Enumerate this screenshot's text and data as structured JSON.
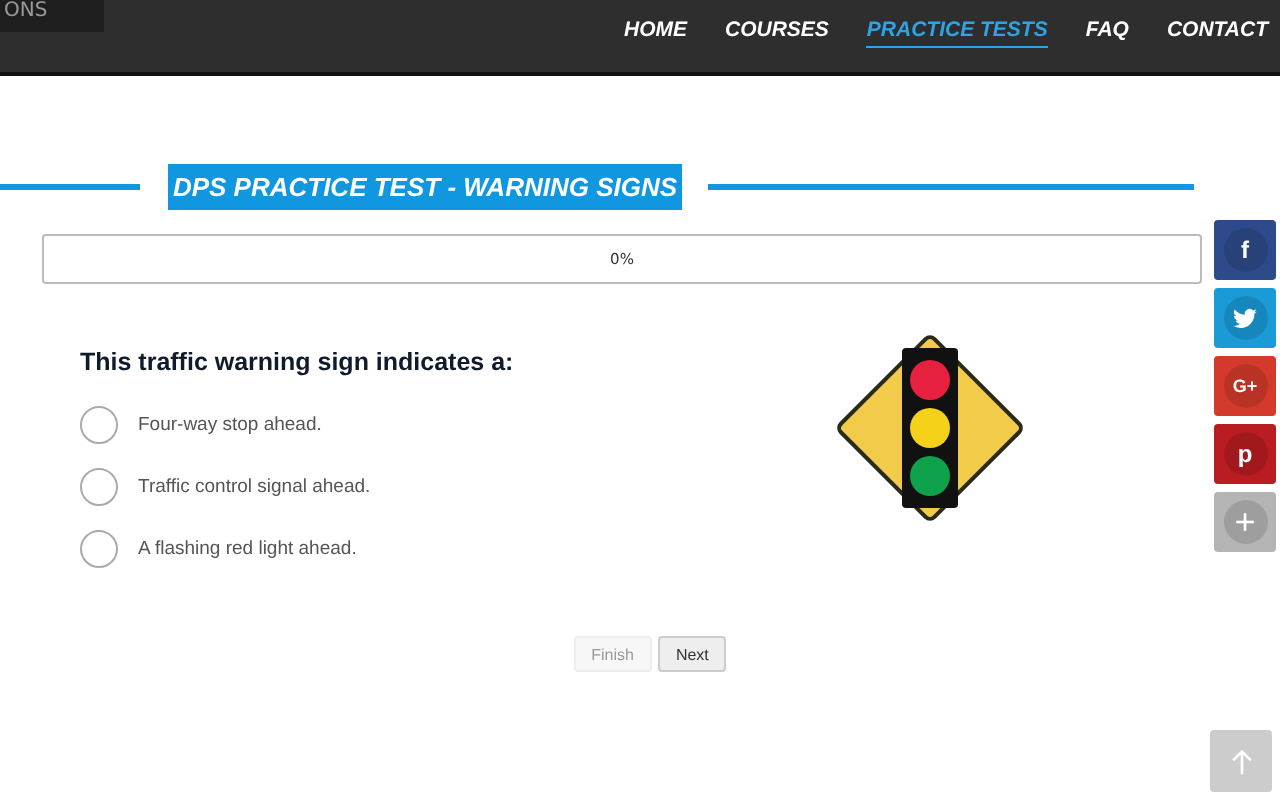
{
  "header": {
    "side_tab": "ONS",
    "nav": [
      {
        "label": "HOME",
        "selected": false
      },
      {
        "label": "COURSES",
        "selected": false
      },
      {
        "label": "PRACTICE TESTS",
        "selected": true
      },
      {
        "label": "FAQ",
        "selected": false
      },
      {
        "label": "CONTACT",
        "selected": false
      }
    ]
  },
  "title": "DPS PRACTICE TEST - WARNING SIGNS",
  "progress": {
    "level": 0,
    "reading": "0%"
  },
  "question": "This traffic warning sign indicates a:",
  "options": [
    {
      "label": "Four-way stop ahead.",
      "selected": false
    },
    {
      "label": "Traffic control signal ahead.",
      "selected": false
    },
    {
      "label": "A flashing red light ahead.",
      "selected": false
    }
  ],
  "buttons": [
    {
      "label": "Finish",
      "disabled": true
    },
    {
      "label": "Next",
      "disabled": false
    }
  ],
  "share": [
    {
      "kind": "facebook",
      "glyph": "f"
    },
    {
      "kind": "twitter"
    },
    {
      "kind": "googleplus",
      "glyph": "G+"
    },
    {
      "kind": "pinterest",
      "glyph": "p"
    },
    {
      "kind": "more",
      "glyph": "+"
    }
  ]
}
